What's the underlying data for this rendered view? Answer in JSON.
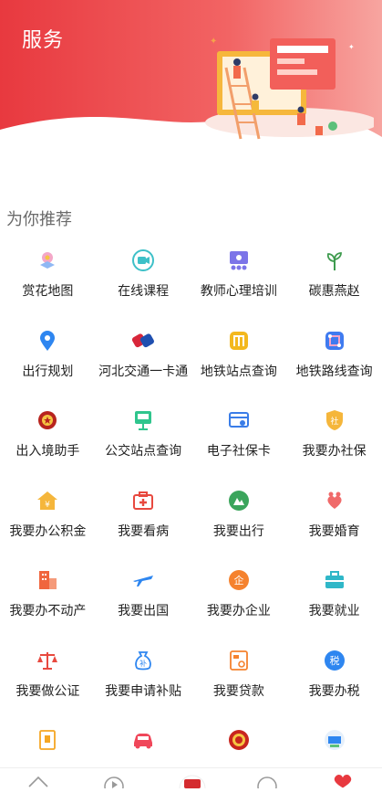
{
  "header": {
    "title": "服务"
  },
  "section": {
    "title": "为你推荐"
  },
  "colors": {
    "brand": "#E8393F",
    "bg": "#FFFFFF"
  },
  "services": [
    {
      "label": "赏花地图",
      "icon": "flower-map-icon"
    },
    {
      "label": "在线课程",
      "icon": "video-course-icon"
    },
    {
      "label": "教师心理培训",
      "icon": "teacher-training-icon"
    },
    {
      "label": "碳惠燕赵",
      "icon": "leaf-icon"
    },
    {
      "label": "出行规划",
      "icon": "location-pin-icon"
    },
    {
      "label": "河北交通一卡通",
      "icon": "transit-card-icon"
    },
    {
      "label": "地铁站点查询",
      "icon": "metro-station-icon"
    },
    {
      "label": "地铁路线查询",
      "icon": "metro-route-icon"
    },
    {
      "label": "出入境助手",
      "icon": "police-badge-icon"
    },
    {
      "label": "公交站点查询",
      "icon": "bus-stop-icon"
    },
    {
      "label": "电子社保卡",
      "icon": "social-security-card-icon"
    },
    {
      "label": "我要办社保",
      "icon": "social-security-shield-icon"
    },
    {
      "label": "我要办公积金",
      "icon": "housing-fund-icon"
    },
    {
      "label": "我要看病",
      "icon": "medical-kit-icon"
    },
    {
      "label": "我要出行",
      "icon": "travel-icon"
    },
    {
      "label": "我要婚育",
      "icon": "marriage-icon"
    },
    {
      "label": "我要办不动产",
      "icon": "real-estate-icon"
    },
    {
      "label": "我要出国",
      "icon": "airplane-icon"
    },
    {
      "label": "我要办企业",
      "icon": "enterprise-icon"
    },
    {
      "label": "我要就业",
      "icon": "briefcase-icon"
    },
    {
      "label": "我要做公证",
      "icon": "scales-icon"
    },
    {
      "label": "我要申请补贴",
      "icon": "subsidy-bag-icon"
    },
    {
      "label": "我要贷款",
      "icon": "loan-card-icon"
    },
    {
      "label": "我要办税",
      "icon": "tax-icon"
    },
    {
      "label": "",
      "icon": "document-icon"
    },
    {
      "label": "",
      "icon": "car-icon"
    },
    {
      "label": "",
      "icon": "national-emblem-icon"
    },
    {
      "label": "",
      "icon": "service-badge-icon"
    }
  ],
  "tabbar": {
    "items": [
      "home-icon",
      "play-icon",
      "center-logo-icon",
      "chat-icon",
      "heart-icon"
    ]
  }
}
